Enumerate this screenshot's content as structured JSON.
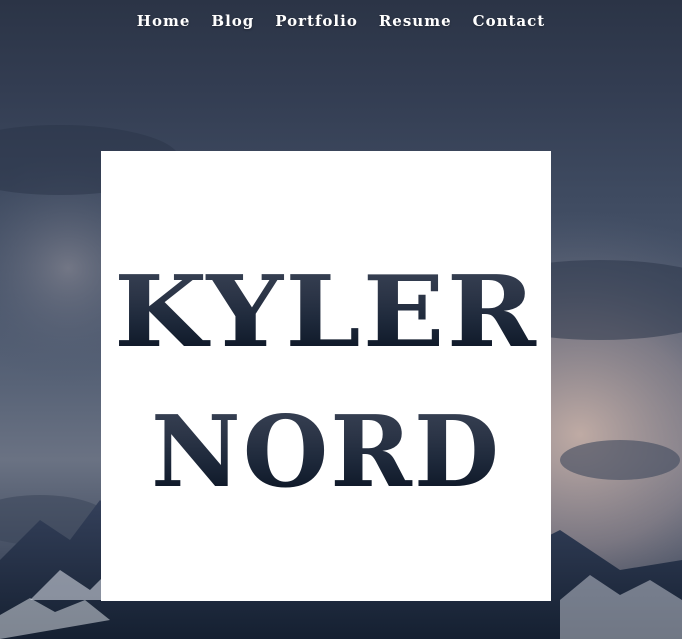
{
  "nav": {
    "items": [
      {
        "label": "Home",
        "id": "home"
      },
      {
        "label": "Blog",
        "id": "blog"
      },
      {
        "label": "Portfolio",
        "id": "portfolio"
      },
      {
        "label": "Resume",
        "id": "resume"
      },
      {
        "label": "Contact",
        "id": "contact"
      }
    ]
  },
  "hero": {
    "name_line1": "KYLER",
    "name_line2": "NORD"
  },
  "colors": {
    "sky_dark": "#2b3446",
    "sky_sunset": "#b9a9a4",
    "mountain_dark": "#1a2536",
    "card_bg": "#ffffff",
    "nav_text": "#ffffff"
  }
}
